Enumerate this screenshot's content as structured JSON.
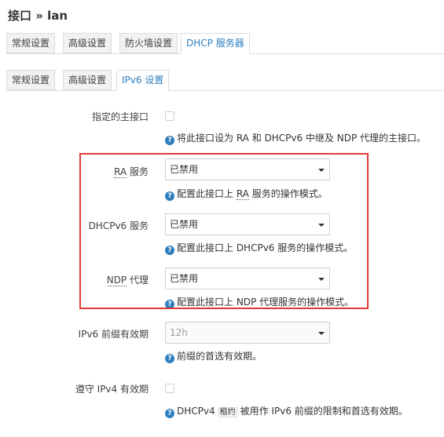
{
  "page": {
    "title": "接口 » lan"
  },
  "tabs_main": [
    "常规设置",
    "高级设置",
    "防火墙设置",
    "DHCP 服务器"
  ],
  "tabs_sub": [
    "常规设置",
    "高级设置",
    "IPv6 设置"
  ],
  "fields": {
    "master": {
      "label": "指定的主接口",
      "help": "将此接口设为 RA 和 DHCPv6 中继及 NDP 代理的主接口。"
    },
    "ra": {
      "label_abbr": "RA",
      "label_rest": " 服务",
      "value": "已禁用",
      "help_pre": "配置此接口上 ",
      "help_abbr": "RA",
      "help_post": " 服务的操作模式。"
    },
    "dhcpv6": {
      "label": "DHCPv6 服务",
      "value": "已禁用",
      "help": "配置此接口上 DHCPv6 服务的操作模式。"
    },
    "ndp": {
      "label_abbr": "NDP",
      "label_rest": " 代理",
      "value": "已禁用",
      "help": "配置此接口上 NDP 代理服务的操作模式。"
    },
    "pref_lifetime": {
      "label": "IPv6 前缀有效期",
      "value": "12h",
      "help": "前缀的首选有效期。"
    },
    "honor_ipv4": {
      "label": "遵守 IPv4 有效期",
      "help_pre": "DHCPv4",
      "help_tag": "租约",
      "help_post": "被用作 IPv6 前缀的限制和首选有效期。"
    }
  },
  "icons": {
    "help": "help-circle-icon",
    "dropdown": "chevron-down-icon"
  },
  "colors": {
    "accent": "#2f7fbf",
    "highlight": "#e53935"
  }
}
